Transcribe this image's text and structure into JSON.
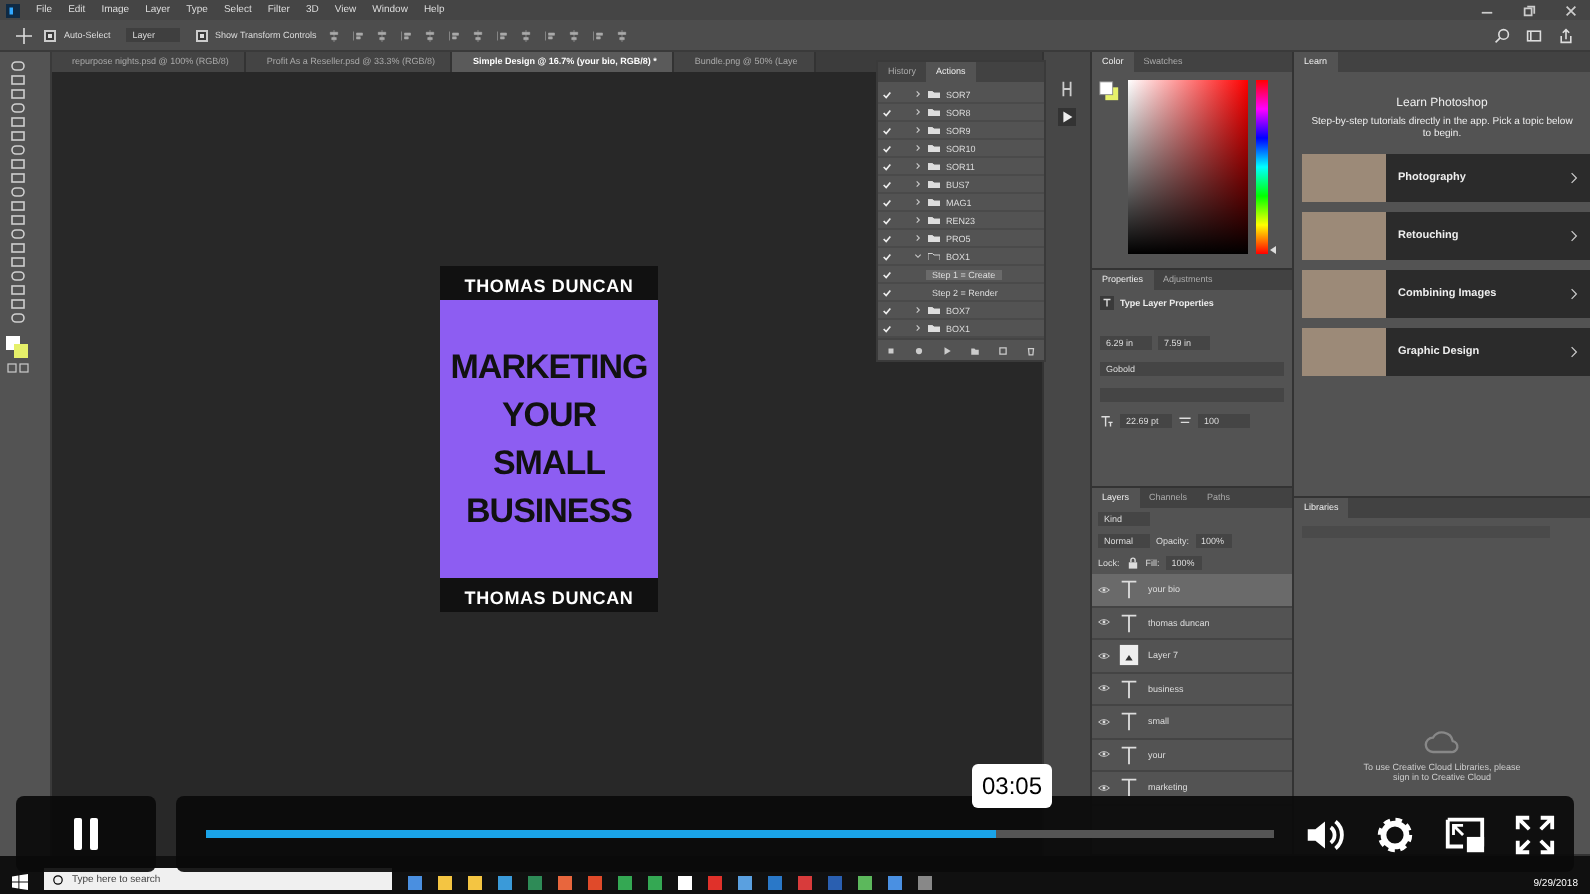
{
  "menu_bar": {
    "items": [
      "File",
      "Edit",
      "Image",
      "Layer",
      "Type",
      "Select",
      "Filter",
      "3D",
      "View",
      "Window",
      "Help"
    ]
  },
  "options_bar": {
    "auto_select": {
      "label": "Auto-Select",
      "checked": true
    },
    "target": "Layer",
    "show_transform": {
      "label": "Show Transform Controls",
      "checked": true
    }
  },
  "document_tabs": [
    {
      "label": "repurpose nights.psd @ 100% (RGB/8)",
      "selected": false
    },
    {
      "label": "Profit As a Reseller.psd @ 33.3% (RGB/8)",
      "selected": false
    },
    {
      "label": "Simple Design @ 16.7% (your bio, RGB/8) *",
      "selected": true
    },
    {
      "label": "Bundle.png @ 50% (Laye",
      "selected": false
    }
  ],
  "poster": {
    "top_name": "THOMAS DUNCAN",
    "headline": [
      "MARKETING",
      "YOUR",
      "SMALL",
      "BUSINESS"
    ],
    "bottom_name": "THOMAS DUNCAN"
  },
  "actions_panel": {
    "tabs": [
      {
        "label": "History",
        "selected": false
      },
      {
        "label": "Actions",
        "selected": true
      }
    ],
    "items": [
      {
        "name": "SOR7",
        "checked": true,
        "expanded": false
      },
      {
        "name": "SOR8",
        "checked": true,
        "expanded": false
      },
      {
        "name": "SOR9",
        "checked": true,
        "expanded": false
      },
      {
        "name": "SOR10",
        "checked": true,
        "expanded": false
      },
      {
        "name": "SOR11",
        "checked": true,
        "expanded": false
      },
      {
        "name": "BUS7",
        "checked": true,
        "expanded": false
      },
      {
        "name": "MAG1",
        "checked": true,
        "expanded": false
      },
      {
        "name": "REN23",
        "checked": true,
        "expanded": false
      },
      {
        "name": "PRO5",
        "checked": true,
        "expanded": false
      },
      {
        "name": "BOX1",
        "checked": true,
        "expanded": true,
        "children": [
          {
            "name": "Step 1 = Create",
            "checked": true,
            "selected": true
          },
          {
            "name": "Step 2 = Render",
            "checked": true,
            "selected": false
          }
        ]
      },
      {
        "name": "BOX7",
        "checked": true,
        "expanded": false
      },
      {
        "name": "BOX1",
        "checked": true,
        "expanded": false
      }
    ]
  },
  "color_panel": {
    "tabs": [
      {
        "label": "Color",
        "selected": true
      },
      {
        "label": "Swatches",
        "selected": false
      }
    ],
    "hue": {
      "level": 0.02
    }
  },
  "properties_panel": {
    "tabs": [
      {
        "label": "Properties",
        "selected": true
      },
      {
        "label": "Adjustments",
        "selected": false
      }
    ],
    "title": "Type Layer Properties",
    "x": "6.29 in",
    "y": "7.59 in",
    "font": "Gobold",
    "size": "22.69 pt",
    "tracking": "100"
  },
  "layers_panel": {
    "tabs": [
      {
        "label": "Layers",
        "selected": true
      },
      {
        "label": "Channels",
        "selected": false
      },
      {
        "label": "Paths",
        "selected": false
      }
    ],
    "filter": "Kind",
    "blend_mode": "Normal",
    "opacity_label": "Opacity:",
    "opacity": "100%",
    "lock_label": "Lock:",
    "fill_label": "Fill:",
    "fill": "100%",
    "layers": [
      {
        "name": "your bio",
        "kind": "text",
        "selected": true
      },
      {
        "name": "thomas duncan",
        "kind": "text",
        "selected": false
      },
      {
        "name": "Layer 7",
        "kind": "image",
        "selected": false
      },
      {
        "name": "business",
        "kind": "text",
        "selected": false
      },
      {
        "name": "small",
        "kind": "text",
        "selected": false
      },
      {
        "name": "your",
        "kind": "text",
        "selected": false
      },
      {
        "name": "marketing",
        "kind": "text",
        "selected": false
      }
    ]
  },
  "learn_panel": {
    "tab": "Learn",
    "title": "Learn Photoshop",
    "intro": "Step-by-step tutorials directly in the app. Pick a topic below to begin.",
    "topics": [
      "Photography",
      "Retouching",
      "Combining Images",
      "Graphic Design"
    ]
  },
  "libraries_panel": {
    "tab": "Libraries",
    "message": "To use Creative Cloud Libraries, please sign in to Creative Cloud"
  },
  "video_player": {
    "time": "03:05",
    "level": 0.74
  },
  "taskbar": {
    "search_placeholder": "Type here to search",
    "date": "9/29/2018"
  }
}
